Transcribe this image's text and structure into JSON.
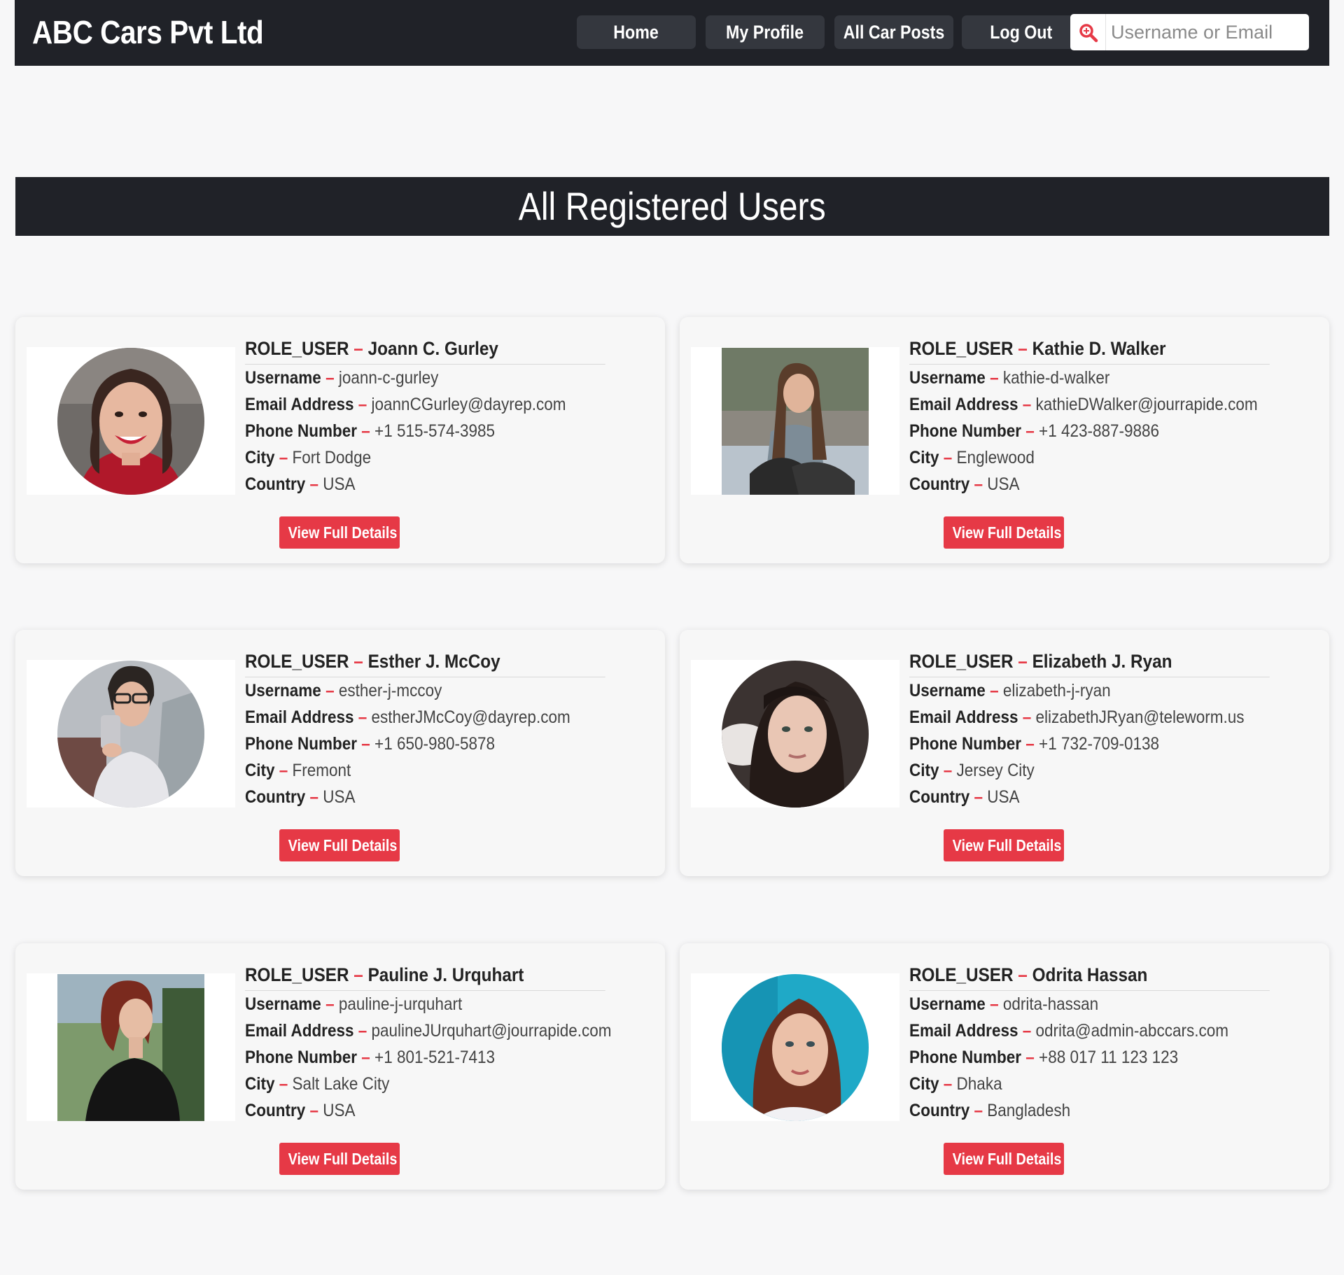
{
  "header": {
    "brand": "ABC Cars Pvt Ltd",
    "nav": {
      "home": "Home",
      "profile": "My Profile",
      "car_posts": "All Car Posts",
      "logout": "Log Out"
    },
    "search": {
      "placeholder": "Username or Email",
      "icon": "search-icon"
    }
  },
  "main": {
    "heading": "All Registered Users",
    "labels": {
      "username": "Username",
      "email": "Email Address",
      "phone": "Phone Number",
      "city": "City",
      "country": "Country",
      "separator": "–",
      "details_button": "View Full Details"
    },
    "users": [
      {
        "role": "ROLE_USER",
        "name": "Joann C. Gurley",
        "username": "joann-c-gurley",
        "email": "joannCGurley@dayrep.com",
        "phone": "+1 515-574-3985",
        "city": "Fort Dodge",
        "country": "USA"
      },
      {
        "role": "ROLE_USER",
        "name": "Kathie D. Walker",
        "username": "kathie-d-walker",
        "email": "kathieDWalker@jourrapide.com",
        "phone": "+1 423-887-9886",
        "city": "Englewood",
        "country": "USA"
      },
      {
        "role": "ROLE_USER",
        "name": "Esther J. McCoy",
        "username": "esther-j-mccoy",
        "email": "estherJMcCoy@dayrep.com",
        "phone": "+1 650-980-5878",
        "city": "Fremont",
        "country": "USA"
      },
      {
        "role": "ROLE_USER",
        "name": "Elizabeth J. Ryan",
        "username": "elizabeth-j-ryan",
        "email": "elizabethJRyan@teleworm.us",
        "phone": "+1 732-709-0138",
        "city": "Jersey City",
        "country": "USA"
      },
      {
        "role": "ROLE_USER",
        "name": "Pauline J. Urquhart",
        "username": "pauline-j-urquhart",
        "email": "paulineJUrquhart@jourrapide.com",
        "phone": "+1 801-521-7413",
        "city": "Salt Lake City",
        "country": "USA"
      },
      {
        "role": "ROLE_USER",
        "name": "Odrita Hassan",
        "username": "odrita-hassan",
        "email": "odrita@admin-abccars.com",
        "phone": "+88 017 11 123 123",
        "city": "Dhaka",
        "country": "Bangladesh"
      }
    ]
  },
  "colors": {
    "navbar_bg": "#202228",
    "nav_button_bg": "#34373e",
    "accent_red": "#e63946",
    "page_bg": "#f7f7f8"
  }
}
